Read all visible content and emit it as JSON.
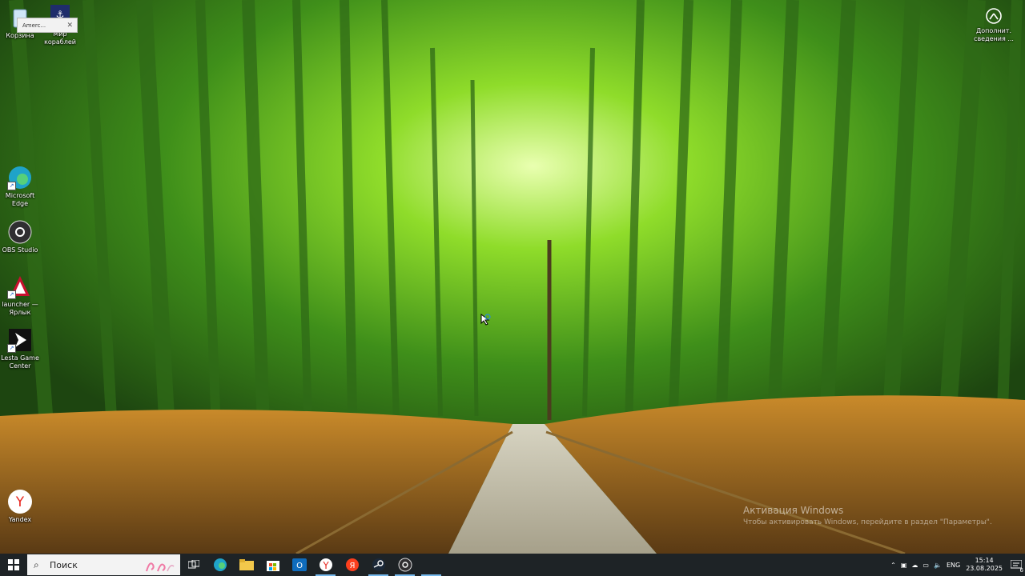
{
  "desktop": {
    "icons": [
      {
        "name": "recycle-bin",
        "label": "Корзина"
      },
      {
        "name": "mir-korabley",
        "label": "Мир кораблей"
      },
      {
        "name": "microsoft-edge",
        "label": "Microsoft Edge"
      },
      {
        "name": "obs-studio",
        "label": "OBS Studio"
      },
      {
        "name": "launcher",
        "label": "launcher — Ярлык"
      },
      {
        "name": "lesta-game-center",
        "label": "Lesta Game Center"
      },
      {
        "name": "yandex",
        "label": "Yandex"
      },
      {
        "name": "additional-info",
        "label": "Дополнит. сведения ..."
      }
    ],
    "tooltip": {
      "label": "Amerc..."
    }
  },
  "watermark": {
    "title": "Активация Windows",
    "subtitle": "Чтобы активировать Windows, перейдите в раздел \"Параметры\"."
  },
  "taskbar": {
    "search_placeholder": "Поиск",
    "apps": [
      "task-view",
      "edge",
      "file-explorer",
      "store",
      "outlook",
      "yandex-browser",
      "yandex",
      "steam",
      "obs"
    ],
    "tray": {
      "lang": "ENG",
      "time": "15:14",
      "date": "23.08.2025",
      "notification_count": "6"
    }
  },
  "colors": {
    "taskbar": "#1e2326",
    "accent": "#76b9ed"
  }
}
